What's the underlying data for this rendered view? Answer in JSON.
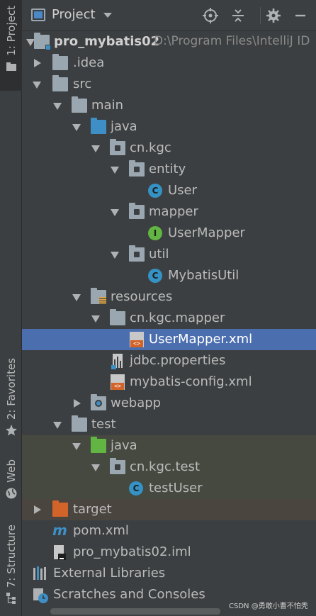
{
  "side_tabs": {
    "project": "1: Project",
    "favorites": "2: Favorites",
    "web": "Web",
    "structure": "7: Structure"
  },
  "header": {
    "title": "Project"
  },
  "tree": [
    {
      "label": "pro_mybatis02",
      "path": "D:\\Program Files\\IntelliJ ID",
      "icon": "module-folder-icon",
      "arrow": "down"
    },
    {
      "label": ".idea",
      "icon": "folder-icon",
      "arrow": "right"
    },
    {
      "label": "src",
      "icon": "folder-icon",
      "arrow": "down"
    },
    {
      "label": "main",
      "icon": "folder-icon",
      "arrow": "down"
    },
    {
      "label": "java",
      "icon": "source-folder-icon",
      "arrow": "down"
    },
    {
      "label": "cn.kgc",
      "icon": "package-icon",
      "arrow": "down"
    },
    {
      "label": "entity",
      "icon": "package-icon",
      "arrow": "down"
    },
    {
      "label": "User",
      "icon": "class-icon"
    },
    {
      "label": "mapper",
      "icon": "package-icon",
      "arrow": "down"
    },
    {
      "label": "UserMapper",
      "icon": "interface-icon"
    },
    {
      "label": "util",
      "icon": "package-icon",
      "arrow": "down"
    },
    {
      "label": "MybatisUtil",
      "icon": "class-icon"
    },
    {
      "label": "resources",
      "icon": "resources-folder-icon",
      "arrow": "down"
    },
    {
      "label": "cn.kgc.mapper",
      "icon": "folder-icon",
      "arrow": "down"
    },
    {
      "label": "UserMapper.xml",
      "icon": "xml-file-icon",
      "selected": true
    },
    {
      "label": "jdbc.properties",
      "icon": "properties-file-icon"
    },
    {
      "label": "mybatis-config.xml",
      "icon": "xml-file-icon"
    },
    {
      "label": "webapp",
      "icon": "web-folder-icon",
      "arrow": "right"
    },
    {
      "label": "test",
      "icon": "folder-icon",
      "arrow": "down"
    },
    {
      "label": "java",
      "icon": "test-folder-icon",
      "arrow": "down"
    },
    {
      "label": "cn.kgc.test",
      "icon": "package-icon",
      "arrow": "down"
    },
    {
      "label": "testUser",
      "icon": "test-class-icon"
    },
    {
      "label": "target",
      "icon": "excluded-folder-icon",
      "arrow": "right"
    },
    {
      "label": "pom.xml",
      "icon": "maven-icon"
    },
    {
      "label": "pro_mybatis02.iml",
      "icon": "iml-file-icon"
    },
    {
      "label": "External Libraries",
      "icon": "libraries-icon",
      "arrow": "right"
    },
    {
      "label": "Scratches and Consoles",
      "icon": "scratches-icon"
    }
  ],
  "watermark": "CSDN @勇敢小曹不怕秃",
  "colors": {
    "background": "#3c3f41",
    "selection": "#4b6eaf",
    "text": "#bbbbbb",
    "folder_blue": "#3d8fc6",
    "folder_green": "#62b543",
    "folder_orange": "#d2642a"
  }
}
